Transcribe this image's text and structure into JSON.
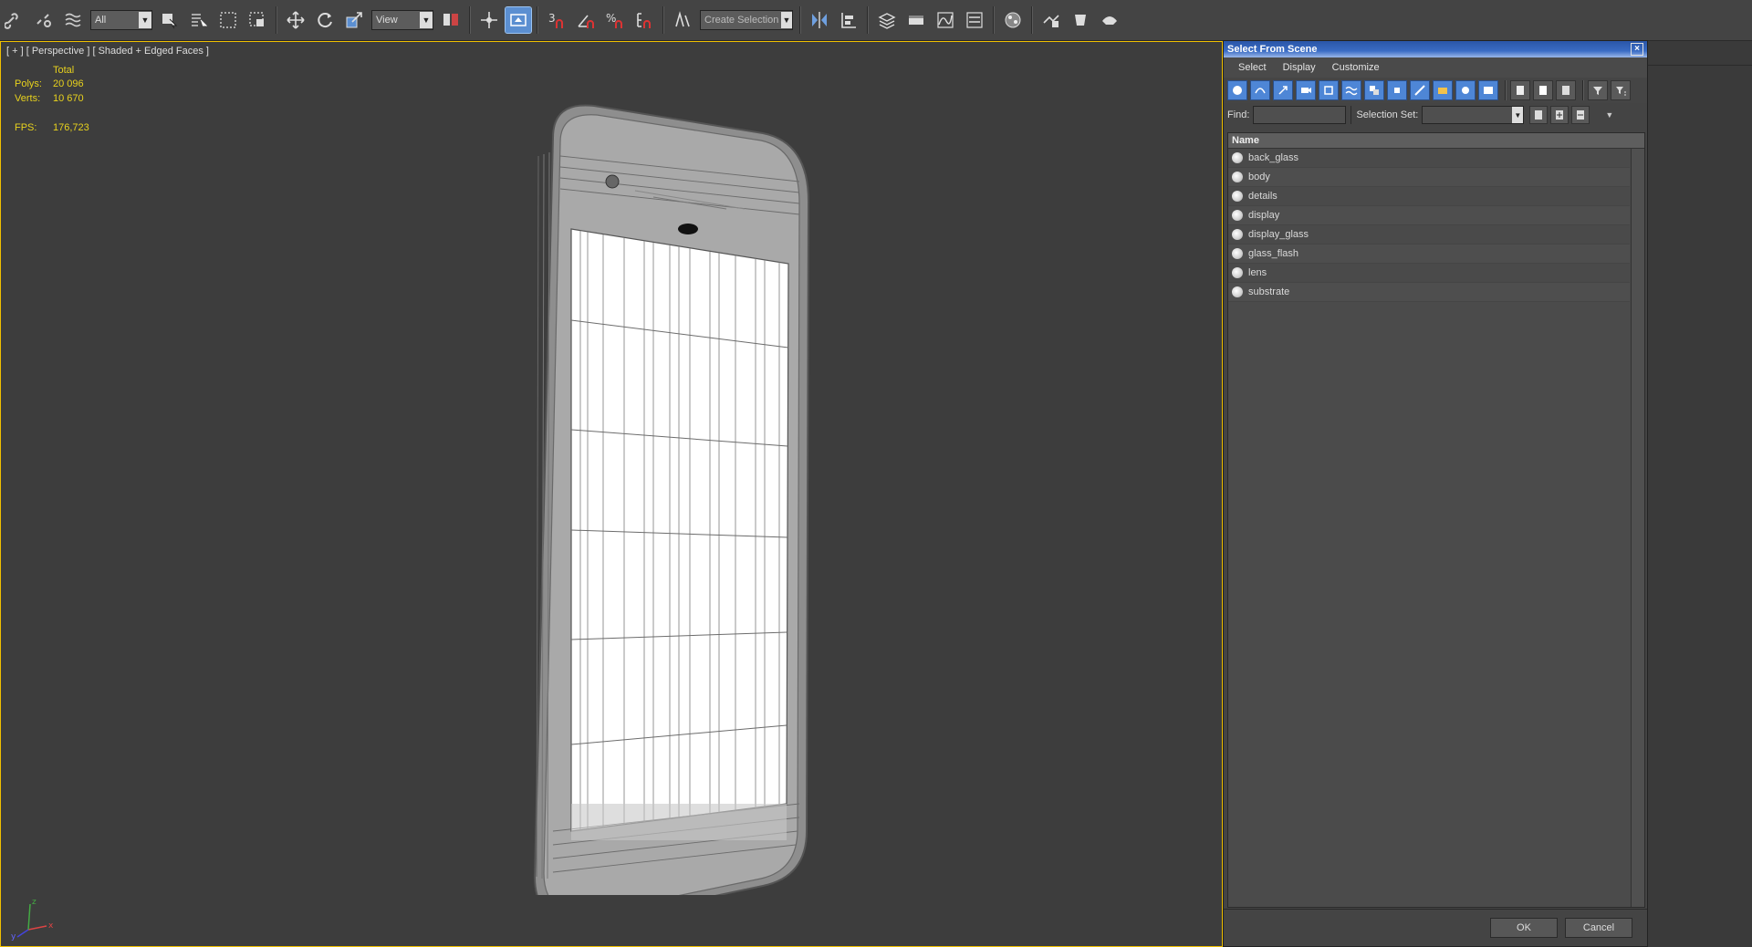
{
  "toolbar": {
    "selection_filter": "All",
    "ref_coord": "View",
    "named_selection_placeholder": "Create Selection Se",
    "snaps": {
      "snap3": "3",
      "percent": "%"
    }
  },
  "viewport": {
    "label": "[ + ] [ Perspective ] [ Shaded + Edged Faces ]",
    "stats": {
      "total_label": "Total",
      "polys_label": "Polys:",
      "polys_value": "20 096",
      "verts_label": "Verts:",
      "verts_value": "10 670",
      "fps_label": "FPS:",
      "fps_value": "176,723"
    },
    "axis": {
      "x": "x",
      "y": "y",
      "z": "z"
    }
  },
  "dialog": {
    "title": "Select From Scene",
    "close": "×",
    "menu": [
      "Select",
      "Display",
      "Customize"
    ],
    "find_label": "Find:",
    "selection_set_label": "Selection Set:",
    "list_header": "Name",
    "objects": [
      "back_glass",
      "body",
      "details",
      "display",
      "display_glass",
      "glass_flash",
      "lens",
      "substrate"
    ],
    "ok": "OK",
    "cancel": "Cancel"
  },
  "colors": {
    "stats_text": "#e8d21d",
    "active_blue": "#5b8fd1",
    "viewport_bg": "#3d3d3d",
    "viewport_border": "#f0c000"
  }
}
